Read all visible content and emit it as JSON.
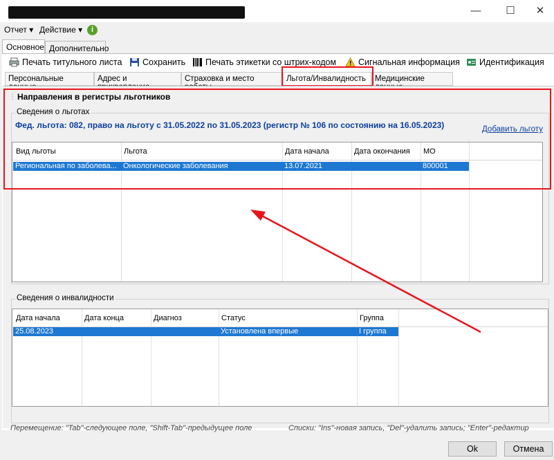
{
  "window": {
    "minimize": "—",
    "maximize": "☐",
    "close": "✕"
  },
  "menu": {
    "report": "Отчет ▾",
    "action": "Действие ▾",
    "info_icon": "i"
  },
  "top_tabs": [
    "Основное",
    "Дополнительно"
  ],
  "toolbar": {
    "print_title": "Печать титульного листа",
    "save": "Сохранить",
    "print_barcode": "Печать этикетки со штрих-кодом",
    "signal": "Сигнальная информация",
    "identification": "Идентификация"
  },
  "sub_tabs": [
    "Персональные данные",
    "Адрес и прикрепление",
    "Страховка и место работы",
    "Льгота/Инвалидность",
    "Медицинские данные"
  ],
  "registry": {
    "title": "Направления в регистры льготников",
    "group_title": "Сведения о льготах",
    "federal_line": "Фед. льгота: 082, право на льготу с 31.05.2022  по 31.05.2023  (регистр № 106 по состоянию на 16.05.2023)",
    "add_link": "Добавить льготу"
  },
  "benefits_table": {
    "columns": [
      "Вид льготы",
      "Льгота",
      "Дата начала",
      "Дата окончания",
      "МО"
    ],
    "rows": [
      [
        "Региональная по заболева...",
        "Онкологические заболевания",
        "13.07.2021",
        "",
        "800001"
      ]
    ]
  },
  "disability": {
    "group_title": "Сведения о инвалидности",
    "columns": [
      "Дата начала",
      "Дата конца",
      "Диагноз",
      "Статус",
      "Группа"
    ],
    "rows": [
      [
        "25.08.2023",
        "",
        "",
        "Установлена впервые",
        "I группа"
      ]
    ]
  },
  "status": {
    "left": "Перемещение: \"Tab\"-следующее поле, \"Shift-Tab\"-предыдущее поле",
    "right": "Списки: \"Ins\"-новая запись, \"Del\"-удалить запись; \"Enter\"-редактир"
  },
  "buttons": {
    "ok": "Ok",
    "cancel": "Отмена"
  },
  "colors": {
    "highlight": "#e8141c",
    "selection": "#1e78d2",
    "link": "#0b3fa0"
  }
}
